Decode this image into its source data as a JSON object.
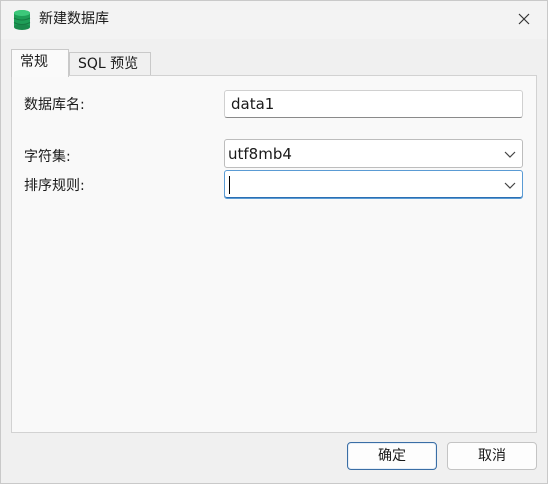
{
  "window": {
    "title": "新建数据库"
  },
  "tabs": [
    {
      "label": "常规",
      "active": true
    },
    {
      "label": "SQL 预览",
      "active": false
    }
  ],
  "form": {
    "db_name": {
      "label": "数据库名:",
      "value": "data1"
    },
    "charset": {
      "label": "字符集:",
      "value": "utf8mb4"
    },
    "collation": {
      "label": "排序规则:",
      "value": ""
    }
  },
  "buttons": {
    "ok": "确定",
    "cancel": "取消"
  },
  "colors": {
    "accent": "#2b6fb3",
    "db_icon": "#1e9e57"
  },
  "icons": {
    "app": "database-icon",
    "close": "close-icon",
    "dropdown": "chevron-down-icon"
  }
}
